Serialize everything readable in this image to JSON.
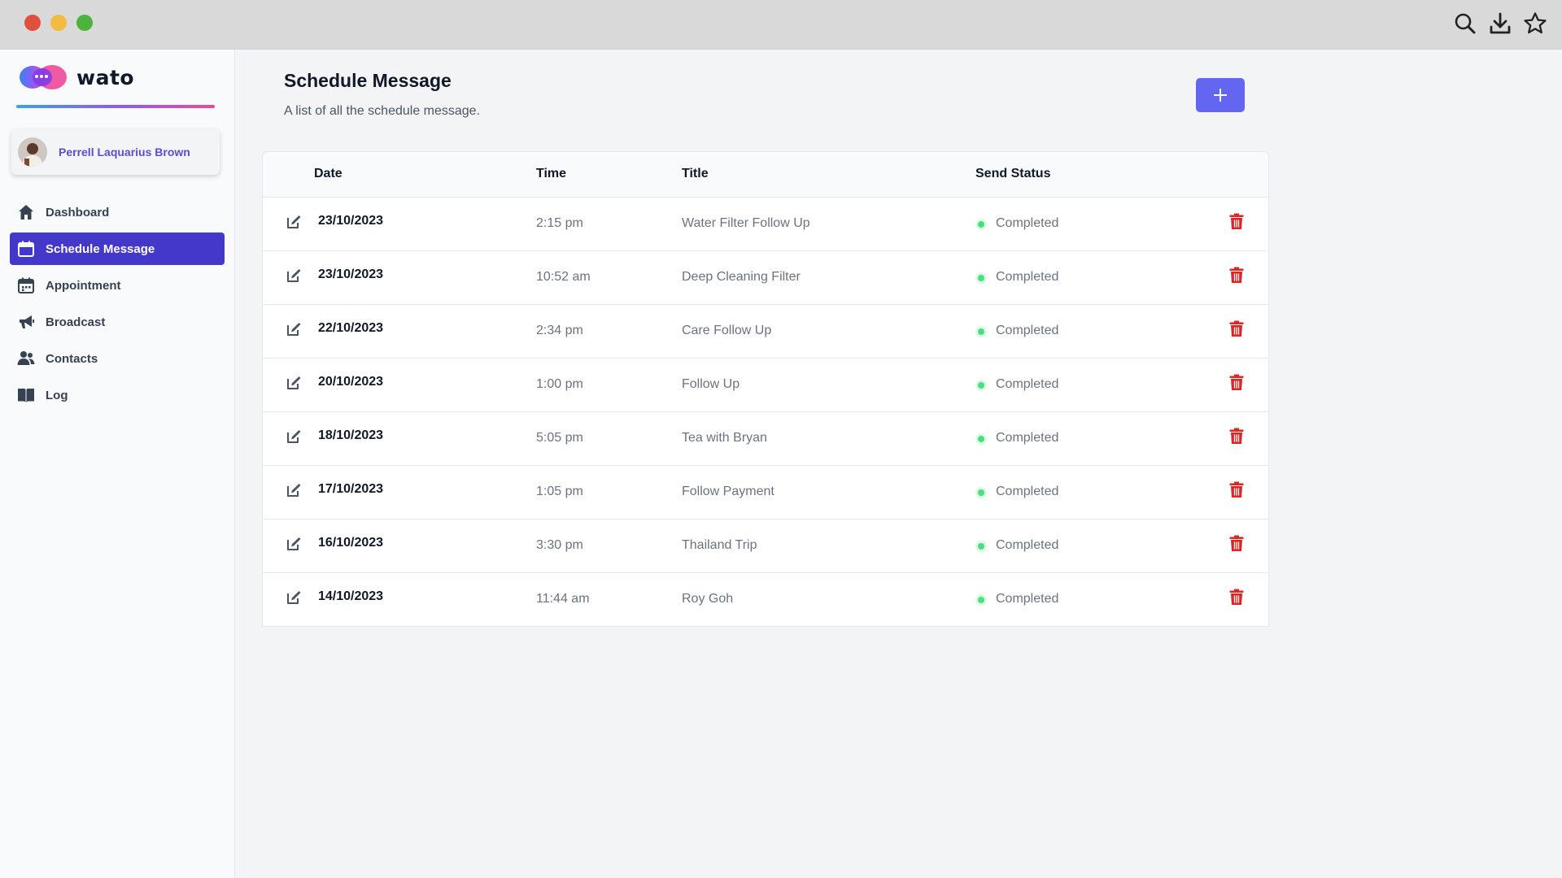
{
  "window": {
    "controls": [
      "close",
      "minimize",
      "maximize"
    ],
    "toolbar_icons": [
      "search-icon",
      "download-icon",
      "star-icon"
    ]
  },
  "sidebar": {
    "brand": "wato",
    "user": {
      "name": "Perrell Laquarius Brown"
    },
    "items": [
      {
        "label": "Dashboard",
        "icon": "home-icon",
        "active": false
      },
      {
        "label": "Schedule Message",
        "icon": "calendar-icon",
        "active": true
      },
      {
        "label": "Appointment",
        "icon": "appointment-calendar-icon",
        "active": false
      },
      {
        "label": "Broadcast",
        "icon": "megaphone-icon",
        "active": false
      },
      {
        "label": "Contacts",
        "icon": "users-icon",
        "active": false
      },
      {
        "label": "Log",
        "icon": "book-icon",
        "active": false
      }
    ]
  },
  "main": {
    "title": "Schedule Message",
    "subtitle": "A list of all the schedule message.",
    "add_button_icon": "plus-icon",
    "table": {
      "headers": {
        "date": "Date",
        "time": "Time",
        "title": "Title",
        "status": "Send Status"
      },
      "rows": [
        {
          "date": "23/10/2023",
          "time": "2:15 pm",
          "title": "Water Filter Follow Up",
          "status": "Completed"
        },
        {
          "date": "23/10/2023",
          "time": "10:52 am",
          "title": "Deep Cleaning Filter",
          "status": "Completed"
        },
        {
          "date": "22/10/2023",
          "time": "2:34 pm",
          "title": "Care Follow Up",
          "status": "Completed"
        },
        {
          "date": "20/10/2023",
          "time": "1:00 pm",
          "title": "Follow Up",
          "status": "Completed"
        },
        {
          "date": "18/10/2023",
          "time": "5:05 pm",
          "title": "Tea with Bryan",
          "status": "Completed"
        },
        {
          "date": "17/10/2023",
          "time": "1:05 pm",
          "title": "Follow Payment",
          "status": "Completed"
        },
        {
          "date": "16/10/2023",
          "time": "3:30 pm",
          "title": "Thailand Trip",
          "status": "Completed"
        },
        {
          "date": "14/10/2023",
          "time": "11:44 am",
          "title": "Roy Goh",
          "status": "Completed"
        }
      ]
    }
  },
  "colors": {
    "accent": "#4338ca",
    "add_button": "#6366f1",
    "status_completed": "#4ade80",
    "delete": "#dc2626"
  }
}
